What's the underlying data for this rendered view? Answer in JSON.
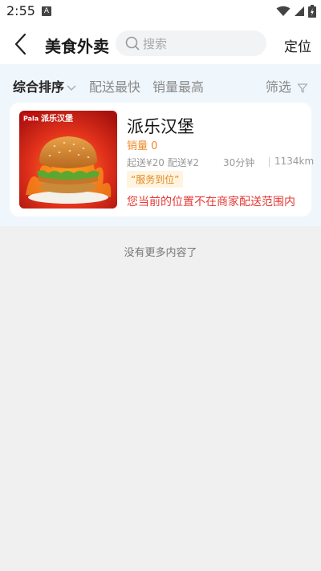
{
  "status_bar": {
    "time": "2:55",
    "notification_badge": "A",
    "icons": [
      "wifi-icon",
      "signal-icon",
      "battery-icon"
    ]
  },
  "header": {
    "title": "美食外卖",
    "search_placeholder": "搜索",
    "locate_label": "定位"
  },
  "sort_bar": {
    "options": [
      {
        "label": "综合排序",
        "active": true,
        "has_dropdown": true
      },
      {
        "label": "配送最快",
        "active": false
      },
      {
        "label": "销量最高",
        "active": false
      }
    ],
    "filter_label": "筛选"
  },
  "shops": [
    {
      "name": "派乐汉堡",
      "image_brand": "派乐汉堡",
      "image_logo": "Pala",
      "sales": "销量 0",
      "min_order": "起送¥20",
      "delivery_fee": "配送¥2",
      "delivery_time": "30分钟",
      "distance": "1134km",
      "tag": "“服务到位”",
      "warning": "您当前的位置不在商家配送范围内"
    }
  ],
  "footer_note": "没有更多内容了",
  "colors": {
    "accent_orange": "#f08a24",
    "warning_red": "#e53935",
    "sort_bar_bg": "#f0f7fc",
    "page_bg": "#f0f0f0"
  }
}
